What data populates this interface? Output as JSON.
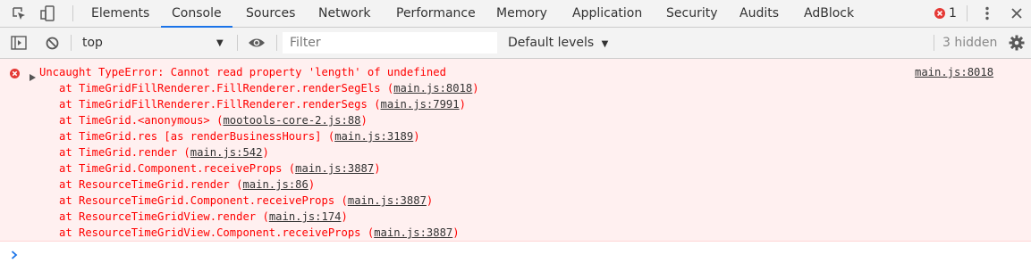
{
  "tabs": {
    "items": [
      {
        "label": "Elements"
      },
      {
        "label": "Console",
        "active": true
      },
      {
        "label": "Sources"
      },
      {
        "label": "Network"
      },
      {
        "label": "Performance"
      },
      {
        "label": "Memory"
      },
      {
        "label": "Application"
      },
      {
        "label": "Security"
      },
      {
        "label": "Audits"
      },
      {
        "label": "AdBlock"
      }
    ],
    "error_count": "1",
    "icons": [
      "inspect-element-icon",
      "device-toolbar-icon",
      "error-icon",
      "more-options-icon",
      "close-icon"
    ]
  },
  "toolbar": {
    "context_value": "top",
    "filter_placeholder": "Filter",
    "levels_label": "Default levels",
    "hidden_label": "3 hidden",
    "icons": [
      "show-sidebar-icon",
      "clear-console-icon",
      "live-expression-eye-icon",
      "settings-gear-icon"
    ]
  },
  "console": {
    "error_message": "Uncaught TypeError: Cannot read property 'length' of undefined",
    "source_link": "main.js:8018",
    "frames": [
      {
        "prefix": "at TimeGridFillRenderer.FillRenderer.renderSegEls (",
        "link": "main.js:8018",
        "suffix": ")"
      },
      {
        "prefix": "at TimeGridFillRenderer.FillRenderer.renderSegs (",
        "link": "main.js:7991",
        "suffix": ")"
      },
      {
        "prefix": "at TimeGrid.<anonymous> (",
        "link": "mootools-core-2.js:88",
        "suffix": ")"
      },
      {
        "prefix": "at TimeGrid.res [as renderBusinessHours] (",
        "link": "main.js:3189",
        "suffix": ")"
      },
      {
        "prefix": "at TimeGrid.render (",
        "link": "main.js:542",
        "suffix": ")"
      },
      {
        "prefix": "at TimeGrid.Component.receiveProps (",
        "link": "main.js:3887",
        "suffix": ")"
      },
      {
        "prefix": "at ResourceTimeGrid.render (",
        "link": "main.js:86",
        "suffix": ")"
      },
      {
        "prefix": "at ResourceTimeGrid.Component.receiveProps (",
        "link": "main.js:3887",
        "suffix": ")"
      },
      {
        "prefix": "at ResourceTimeGridView.render (",
        "link": "main.js:174",
        "suffix": ")"
      },
      {
        "prefix": "at ResourceTimeGridView.Component.receiveProps (",
        "link": "main.js:3887",
        "suffix": ")"
      }
    ]
  },
  "colors": {
    "error_text": "#ff0000",
    "error_background": "#fff0f0",
    "error_icon": "#e53935",
    "active_tab_underline": "#1a73e8",
    "prompt_arrow": "#1a73e8"
  }
}
